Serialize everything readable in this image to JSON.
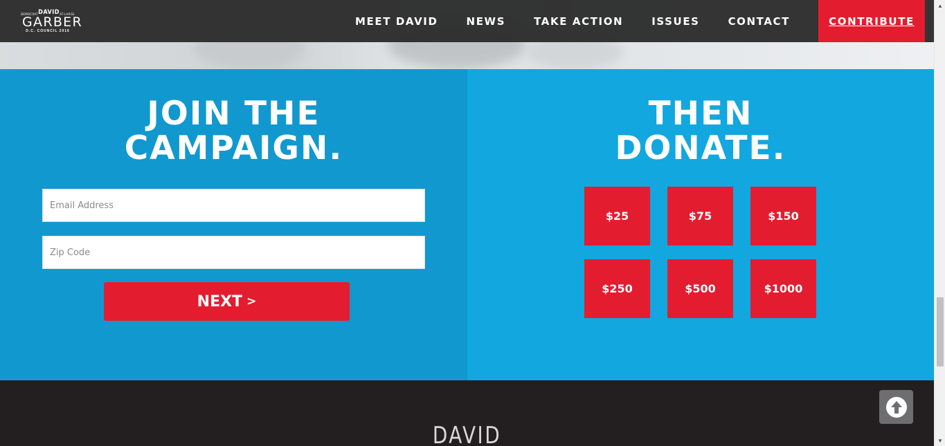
{
  "logo": {
    "small_left": "DEMOCRAT",
    "name_top": "DAVID",
    "small_right": "AT-LARGE",
    "name_main": "GARBER",
    "bottom": "D.C. COUNCIL 2016"
  },
  "nav": {
    "items": [
      {
        "label": "MEET DAVID"
      },
      {
        "label": "NEWS"
      },
      {
        "label": "TAKE ACTION"
      },
      {
        "label": "ISSUES"
      },
      {
        "label": "CONTACT"
      }
    ],
    "contribute_label": "CONTRIBUTE"
  },
  "join": {
    "heading_line1": "JOIN THE",
    "heading_line2": "CAMPAIGN.",
    "email_placeholder": "Email Address",
    "zip_placeholder": "Zip Code",
    "next_label": "NEXT",
    "next_chevron": ">"
  },
  "donate": {
    "heading_line1": "THEN",
    "heading_line2": "DONATE.",
    "amounts": [
      "$25",
      "$75",
      "$150",
      "$250",
      "$500",
      "$1000"
    ]
  },
  "footer": {
    "name": "DAVID"
  },
  "colors": {
    "nav_bg": "#2d2d2d",
    "brand_red": "#e41c2f",
    "left_panel_blue": "#1198cf",
    "right_panel_blue": "#12a7df",
    "footer_bg": "#231f20"
  },
  "icons": {
    "back_to_top": "arrow-up-circle-icon"
  }
}
